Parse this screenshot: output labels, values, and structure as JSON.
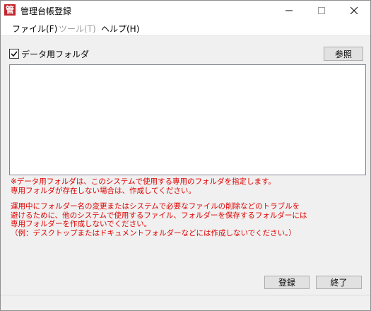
{
  "window": {
    "title": "管理台帳登録",
    "app_icon_glyph": "管",
    "accent_color": "#c1272d",
    "controls": [
      "minimize-icon",
      "maximize-icon",
      "close-icon"
    ]
  },
  "menu": {
    "items": [
      {
        "label": "ファイル(F)",
        "enabled": true
      },
      {
        "label": "ツール(T)",
        "enabled": false
      },
      {
        "label": "ヘルプ(H)",
        "enabled": true
      }
    ]
  },
  "folder": {
    "checkbox_label": "データ用フォルダ",
    "checked": true,
    "browse_label": "参照",
    "path_value": ""
  },
  "notes": {
    "color": "#e00000",
    "line1": "※データ用フォルダは、このシステムで使用する専用のフォルダを指定します。\n専用フォルダが存在しない場合は、作成してください。",
    "line2": "運用中にフォルダー名の変更またはシステムで必要なファイルの削除などのトラブルを\n避けるために、他のシステムで使用するファイル、フォルダーを保存するフォルダーには\n専用フォルダーを作成しないでください。\n（例：デスクトップまたはドキュメントフォルダーなどには作成しないでください。）"
  },
  "buttons": {
    "register_label": "登録",
    "exit_label": "終了"
  }
}
